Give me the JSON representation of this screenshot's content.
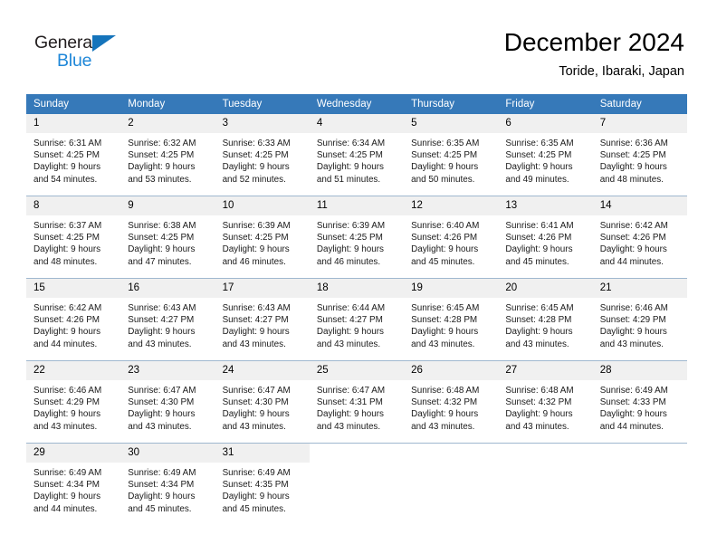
{
  "brand": {
    "name_part1": "General",
    "name_part2": "Blue",
    "triangle_color": "#1574bb",
    "blue_color": "#1f87d8"
  },
  "header": {
    "title": "December 2024",
    "location": "Toride, Ibaraki, Japan"
  },
  "theme": {
    "header_row_bg": "#3679b9",
    "header_row_text": "#ffffff",
    "daynum_bg": "#f0f0f0",
    "row_divider": "#9fb8cf",
    "cell_bg": "#ffffff"
  },
  "weekdays": [
    "Sunday",
    "Monday",
    "Tuesday",
    "Wednesday",
    "Thursday",
    "Friday",
    "Saturday"
  ],
  "weeks": [
    [
      {
        "day": "1",
        "sunrise": "Sunrise: 6:31 AM",
        "sunset": "Sunset: 4:25 PM",
        "daylight1": "Daylight: 9 hours",
        "daylight2": "and 54 minutes."
      },
      {
        "day": "2",
        "sunrise": "Sunrise: 6:32 AM",
        "sunset": "Sunset: 4:25 PM",
        "daylight1": "Daylight: 9 hours",
        "daylight2": "and 53 minutes."
      },
      {
        "day": "3",
        "sunrise": "Sunrise: 6:33 AM",
        "sunset": "Sunset: 4:25 PM",
        "daylight1": "Daylight: 9 hours",
        "daylight2": "and 52 minutes."
      },
      {
        "day": "4",
        "sunrise": "Sunrise: 6:34 AM",
        "sunset": "Sunset: 4:25 PM",
        "daylight1": "Daylight: 9 hours",
        "daylight2": "and 51 minutes."
      },
      {
        "day": "5",
        "sunrise": "Sunrise: 6:35 AM",
        "sunset": "Sunset: 4:25 PM",
        "daylight1": "Daylight: 9 hours",
        "daylight2": "and 50 minutes."
      },
      {
        "day": "6",
        "sunrise": "Sunrise: 6:35 AM",
        "sunset": "Sunset: 4:25 PM",
        "daylight1": "Daylight: 9 hours",
        "daylight2": "and 49 minutes."
      },
      {
        "day": "7",
        "sunrise": "Sunrise: 6:36 AM",
        "sunset": "Sunset: 4:25 PM",
        "daylight1": "Daylight: 9 hours",
        "daylight2": "and 48 minutes."
      }
    ],
    [
      {
        "day": "8",
        "sunrise": "Sunrise: 6:37 AM",
        "sunset": "Sunset: 4:25 PM",
        "daylight1": "Daylight: 9 hours",
        "daylight2": "and 48 minutes."
      },
      {
        "day": "9",
        "sunrise": "Sunrise: 6:38 AM",
        "sunset": "Sunset: 4:25 PM",
        "daylight1": "Daylight: 9 hours",
        "daylight2": "and 47 minutes."
      },
      {
        "day": "10",
        "sunrise": "Sunrise: 6:39 AM",
        "sunset": "Sunset: 4:25 PM",
        "daylight1": "Daylight: 9 hours",
        "daylight2": "and 46 minutes."
      },
      {
        "day": "11",
        "sunrise": "Sunrise: 6:39 AM",
        "sunset": "Sunset: 4:25 PM",
        "daylight1": "Daylight: 9 hours",
        "daylight2": "and 46 minutes."
      },
      {
        "day": "12",
        "sunrise": "Sunrise: 6:40 AM",
        "sunset": "Sunset: 4:26 PM",
        "daylight1": "Daylight: 9 hours",
        "daylight2": "and 45 minutes."
      },
      {
        "day": "13",
        "sunrise": "Sunrise: 6:41 AM",
        "sunset": "Sunset: 4:26 PM",
        "daylight1": "Daylight: 9 hours",
        "daylight2": "and 45 minutes."
      },
      {
        "day": "14",
        "sunrise": "Sunrise: 6:42 AM",
        "sunset": "Sunset: 4:26 PM",
        "daylight1": "Daylight: 9 hours",
        "daylight2": "and 44 minutes."
      }
    ],
    [
      {
        "day": "15",
        "sunrise": "Sunrise: 6:42 AM",
        "sunset": "Sunset: 4:26 PM",
        "daylight1": "Daylight: 9 hours",
        "daylight2": "and 44 minutes."
      },
      {
        "day": "16",
        "sunrise": "Sunrise: 6:43 AM",
        "sunset": "Sunset: 4:27 PM",
        "daylight1": "Daylight: 9 hours",
        "daylight2": "and 43 minutes."
      },
      {
        "day": "17",
        "sunrise": "Sunrise: 6:43 AM",
        "sunset": "Sunset: 4:27 PM",
        "daylight1": "Daylight: 9 hours",
        "daylight2": "and 43 minutes."
      },
      {
        "day": "18",
        "sunrise": "Sunrise: 6:44 AM",
        "sunset": "Sunset: 4:27 PM",
        "daylight1": "Daylight: 9 hours",
        "daylight2": "and 43 minutes."
      },
      {
        "day": "19",
        "sunrise": "Sunrise: 6:45 AM",
        "sunset": "Sunset: 4:28 PM",
        "daylight1": "Daylight: 9 hours",
        "daylight2": "and 43 minutes."
      },
      {
        "day": "20",
        "sunrise": "Sunrise: 6:45 AM",
        "sunset": "Sunset: 4:28 PM",
        "daylight1": "Daylight: 9 hours",
        "daylight2": "and 43 minutes."
      },
      {
        "day": "21",
        "sunrise": "Sunrise: 6:46 AM",
        "sunset": "Sunset: 4:29 PM",
        "daylight1": "Daylight: 9 hours",
        "daylight2": "and 43 minutes."
      }
    ],
    [
      {
        "day": "22",
        "sunrise": "Sunrise: 6:46 AM",
        "sunset": "Sunset: 4:29 PM",
        "daylight1": "Daylight: 9 hours",
        "daylight2": "and 43 minutes."
      },
      {
        "day": "23",
        "sunrise": "Sunrise: 6:47 AM",
        "sunset": "Sunset: 4:30 PM",
        "daylight1": "Daylight: 9 hours",
        "daylight2": "and 43 minutes."
      },
      {
        "day": "24",
        "sunrise": "Sunrise: 6:47 AM",
        "sunset": "Sunset: 4:30 PM",
        "daylight1": "Daylight: 9 hours",
        "daylight2": "and 43 minutes."
      },
      {
        "day": "25",
        "sunrise": "Sunrise: 6:47 AM",
        "sunset": "Sunset: 4:31 PM",
        "daylight1": "Daylight: 9 hours",
        "daylight2": "and 43 minutes."
      },
      {
        "day": "26",
        "sunrise": "Sunrise: 6:48 AM",
        "sunset": "Sunset: 4:32 PM",
        "daylight1": "Daylight: 9 hours",
        "daylight2": "and 43 minutes."
      },
      {
        "day": "27",
        "sunrise": "Sunrise: 6:48 AM",
        "sunset": "Sunset: 4:32 PM",
        "daylight1": "Daylight: 9 hours",
        "daylight2": "and 43 minutes."
      },
      {
        "day": "28",
        "sunrise": "Sunrise: 6:49 AM",
        "sunset": "Sunset: 4:33 PM",
        "daylight1": "Daylight: 9 hours",
        "daylight2": "and 44 minutes."
      }
    ],
    [
      {
        "day": "29",
        "sunrise": "Sunrise: 6:49 AM",
        "sunset": "Sunset: 4:34 PM",
        "daylight1": "Daylight: 9 hours",
        "daylight2": "and 44 minutes."
      },
      {
        "day": "30",
        "sunrise": "Sunrise: 6:49 AM",
        "sunset": "Sunset: 4:34 PM",
        "daylight1": "Daylight: 9 hours",
        "daylight2": "and 45 minutes."
      },
      {
        "day": "31",
        "sunrise": "Sunrise: 6:49 AM",
        "sunset": "Sunset: 4:35 PM",
        "daylight1": "Daylight: 9 hours",
        "daylight2": "and 45 minutes."
      },
      {
        "day": "",
        "sunrise": "",
        "sunset": "",
        "daylight1": "",
        "daylight2": ""
      },
      {
        "day": "",
        "sunrise": "",
        "sunset": "",
        "daylight1": "",
        "daylight2": ""
      },
      {
        "day": "",
        "sunrise": "",
        "sunset": "",
        "daylight1": "",
        "daylight2": ""
      },
      {
        "day": "",
        "sunrise": "",
        "sunset": "",
        "daylight1": "",
        "daylight2": ""
      }
    ]
  ]
}
